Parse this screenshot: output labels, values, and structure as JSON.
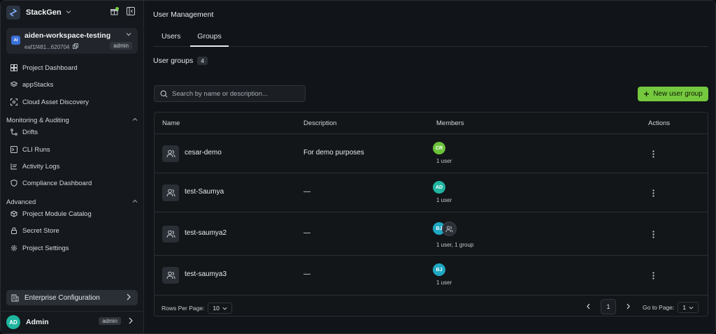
{
  "brand": {
    "name": "StackGen"
  },
  "workspace": {
    "badge": "AI",
    "name": "aiden-workspace-testing",
    "id": "eaf1f481...620704",
    "role": "admin"
  },
  "nav": {
    "project_dashboard": "Project Dashboard",
    "appstacks": "appStacks",
    "cloud_asset_discovery": "Cloud Asset Discovery",
    "section_monitoring": "Monitoring & Auditing",
    "drifts": "Drifts",
    "cli_runs": "CLI Runs",
    "activity_logs": "Activity Logs",
    "compliance_dashboard": "Compliance Dashboard",
    "section_advanced": "Advanced",
    "project_module_catalog": "Project Module Catalog",
    "secret_store": "Secret Store",
    "project_settings": "Project Settings"
  },
  "enterprise": {
    "label": "Enterprise Configuration"
  },
  "user": {
    "initials": "AD",
    "name": "Admin",
    "role": "admin"
  },
  "page": {
    "title": "User Management"
  },
  "tabs": {
    "users": "Users",
    "groups": "Groups"
  },
  "groups_header": {
    "title": "User groups",
    "count": "4"
  },
  "search": {
    "placeholder": "Search by name or description..."
  },
  "new_group_button": "New user group",
  "table": {
    "headers": {
      "name": "Name",
      "description": "Description",
      "members": "Members",
      "actions": "Actions"
    },
    "rows": [
      {
        "name": "cesar-demo",
        "description": "For demo purposes",
        "members_text": "1 user",
        "avatars": [
          {
            "initials": "CR",
            "color": "#6cc23a"
          }
        ],
        "has_group": false
      },
      {
        "name": "test-Saumya",
        "description": "—",
        "members_text": "1 user",
        "avatars": [
          {
            "initials": "AD",
            "color": "#1fb5a0"
          }
        ],
        "has_group": false
      },
      {
        "name": "test-saumya2",
        "description": "—",
        "members_text": "1 user, 1 group",
        "avatars": [
          {
            "initials": "BJ",
            "color": "#1fa8c2"
          }
        ],
        "has_group": true
      },
      {
        "name": "test-saumya3",
        "description": "—",
        "members_text": "1 user",
        "avatars": [
          {
            "initials": "BJ",
            "color": "#1fa8c2"
          }
        ],
        "has_group": false
      }
    ]
  },
  "footer": {
    "rows_per_page_label": "Rows Per Page:",
    "rows_per_page_value": "10",
    "current_page": "1",
    "go_to_label": "Go to Page:",
    "go_to_value": "1"
  },
  "colors": {
    "accent": "#75c93e",
    "background": "#111418",
    "sidebar": "#15181c"
  }
}
